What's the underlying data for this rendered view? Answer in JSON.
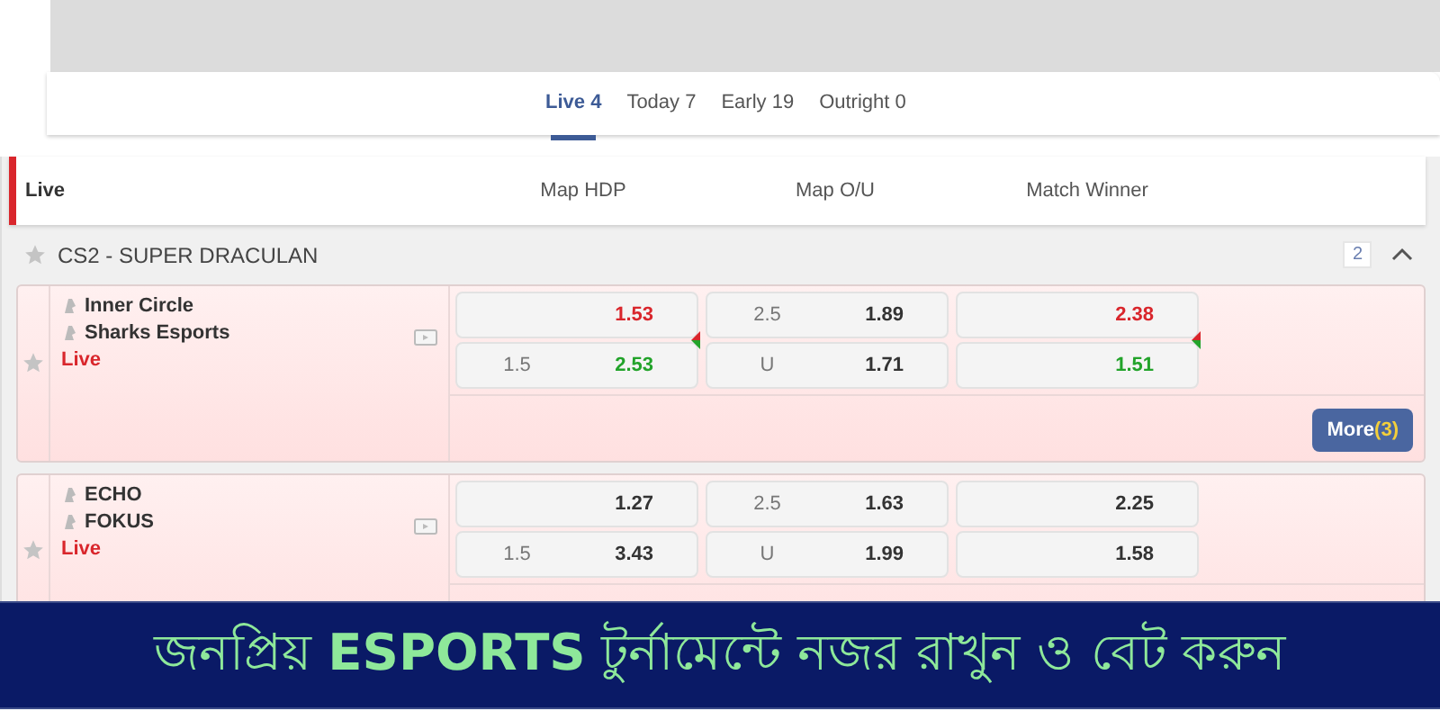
{
  "tabs": [
    {
      "label": "Live 4",
      "selected": true
    },
    {
      "label": "Today 7",
      "selected": false
    },
    {
      "label": "Early 19",
      "selected": false
    },
    {
      "label": "Outright 0",
      "selected": false
    }
  ],
  "header": {
    "section": "Live",
    "columns": [
      "Map HDP",
      "Map O/U",
      "Match Winner"
    ]
  },
  "league": {
    "name": "CS2 - SUPER DRACULAN",
    "count": "2",
    "expanded": true,
    "favorite": false
  },
  "matches": [
    {
      "teams": [
        "Inner Circle",
        "Sharks Esports"
      ],
      "status": "Live",
      "favorite": false,
      "odds": [
        [
          {
            "price": "1.53",
            "rising": false,
            "falling": true
          },
          {
            "line": "1.5",
            "price": "2.53",
            "rising": true,
            "falling": false
          }
        ],
        [
          {
            "line": "2.5",
            "price": "1.89",
            "rising": false,
            "falling": false
          },
          {
            "line": "U",
            "price": "1.71",
            "rising": false,
            "falling": false
          }
        ],
        [
          {
            "price": "2.38",
            "rising": false,
            "falling": true
          },
          {
            "price": "1.51",
            "rising": true,
            "falling": false
          }
        ]
      ],
      "more": {
        "label": "More",
        "count": "(3)"
      }
    },
    {
      "teams": [
        "ECHO",
        "FOKUS"
      ],
      "status": "Live",
      "favorite": false,
      "odds": [
        [
          {
            "price": "1.27",
            "rising": false,
            "falling": false
          },
          {
            "line": "1.5",
            "price": "3.43",
            "rising": false,
            "falling": false
          }
        ],
        [
          {
            "line": "2.5",
            "price": "1.63",
            "rising": false,
            "falling": false
          },
          {
            "line": "U",
            "price": "1.99",
            "rising": false,
            "falling": false
          }
        ],
        [
          {
            "price": "2.25",
            "rising": false,
            "falling": false
          },
          {
            "price": "1.58",
            "rising": false,
            "falling": false
          }
        ]
      ]
    }
  ],
  "banner": {
    "text": "জনপ্রিয় **ESPORTS** টুর্নামেন্টে নজর রাখুন ও বেট করুন"
  }
}
